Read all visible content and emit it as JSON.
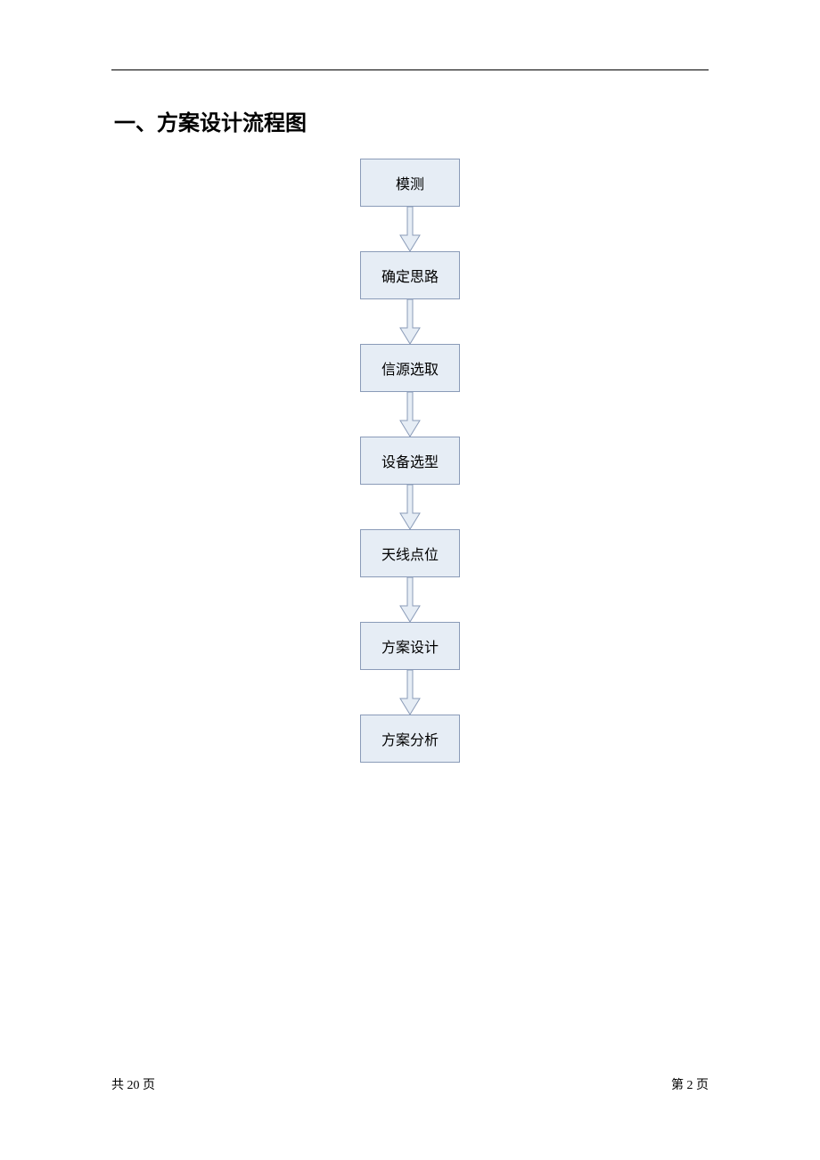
{
  "heading": "一、方案设计流程图",
  "flowchart": {
    "steps": [
      "模测",
      "确定思路",
      "信源选取",
      "设备选型",
      "天线点位",
      "方案设计",
      "方案分析"
    ]
  },
  "footer": {
    "total_pages_label": "共 20 页",
    "current_page_label": "第 2 页"
  },
  "colors": {
    "box_fill": "#e6edf5",
    "box_border": "#8a9bb8",
    "arrow_fill": "#e6edf5",
    "arrow_border": "#8a9bb8"
  }
}
